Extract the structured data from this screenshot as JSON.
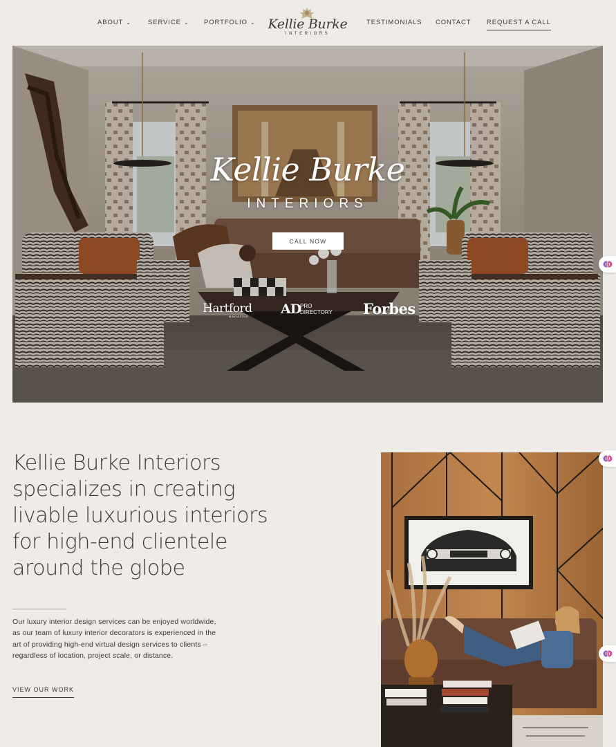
{
  "nav": {
    "items_left": [
      {
        "label": "ABOUT",
        "dropdown": true
      },
      {
        "label": "SERVICE",
        "dropdown": true
      },
      {
        "label": "PORTFOLIO",
        "dropdown": true
      }
    ],
    "items_right": [
      {
        "label": "TESTIMONIALS"
      },
      {
        "label": "CONTACT"
      },
      {
        "label": "REQUEST A CALL"
      }
    ],
    "chevron": "⌄"
  },
  "logo": {
    "script": "Kellie Burke",
    "sub": "INTERIORS"
  },
  "hero": {
    "title": "Kellie Burke",
    "subtitle": "INTERIORS",
    "button": "CALL NOW",
    "press": {
      "hartford": "Hartford",
      "hartford_sub": "MAGAZINE",
      "ad": "AD",
      "ad_sub_1": "PRO",
      "ad_sub_2": "DIRECTORY",
      "forbes": "Forbes"
    }
  },
  "intro": {
    "headline_lines": [
      "Kellie Burke Interiors",
      "specializes in creating",
      "livable luxurious interiors",
      "for high-end clientele",
      "around the globe"
    ],
    "body": "Our luxury interior design services can be enjoyed worldwide, as our team of luxury interior decorators is experienced in the art of providing high-end virtual design services to clients – regardless of location, project scale, or distance.",
    "link": "VIEW OUR WORK"
  },
  "widget": {
    "icon": "brain-icon"
  },
  "colors": {
    "background": "#efebe7",
    "text": "#3b3835",
    "button_bg": "#ffffff"
  }
}
